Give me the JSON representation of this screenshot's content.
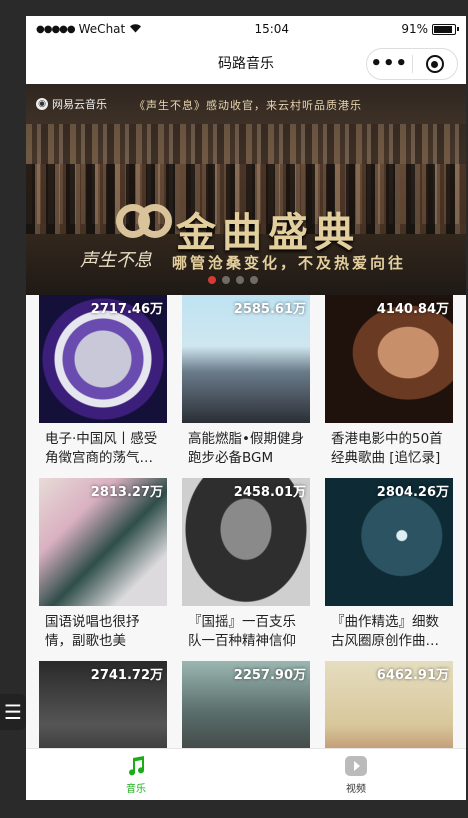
{
  "status_bar": {
    "carrier": "WeChat",
    "time": "15:04",
    "battery_pct": "91%",
    "battery_level": 0.91
  },
  "navbar": {
    "title": "码路音乐",
    "more_label": "•••"
  },
  "banner": {
    "brand": "网易云音乐",
    "tagline": "《声生不息》感动收官，来云村听品质港乐",
    "subtitle": "声生不息",
    "headline": "金曲盛典",
    "slogan": "哪管沧桑变化，不及热爱向往",
    "slide_count": 4,
    "active_slide": 0
  },
  "playlists": [
    {
      "count": "2717.46万",
      "title": "电子·中国风丨感受角徵宫商的荡气回肠"
    },
    {
      "count": "2585.61万",
      "title": "高能燃脂•假期健身跑步必备BGM"
    },
    {
      "count": "4140.84万",
      "title": "香港电影中的50首经典歌曲 [追忆录]"
    },
    {
      "count": "2813.27万",
      "title": "国语说唱也很抒情，副歌也美"
    },
    {
      "count": "2458.01万",
      "title": "『国摇』一百支乐队一百种精神信仰"
    },
    {
      "count": "2804.26万",
      "title": "『曲作精选』细数古风圈原创作曲大神"
    },
    {
      "count": "2741.72万",
      "title": ""
    },
    {
      "count": "2257.90万",
      "title": ""
    },
    {
      "count": "6462.91万",
      "title": ""
    }
  ],
  "tabbar": {
    "tabs": [
      {
        "label": "音乐",
        "icon": "music-note-icon",
        "active": true
      },
      {
        "label": "视频",
        "icon": "video-play-icon",
        "active": false
      }
    ]
  },
  "side_button": {
    "label": "☰"
  },
  "colors": {
    "accent": "#1aad19",
    "indicator_active": "#d43c33"
  }
}
